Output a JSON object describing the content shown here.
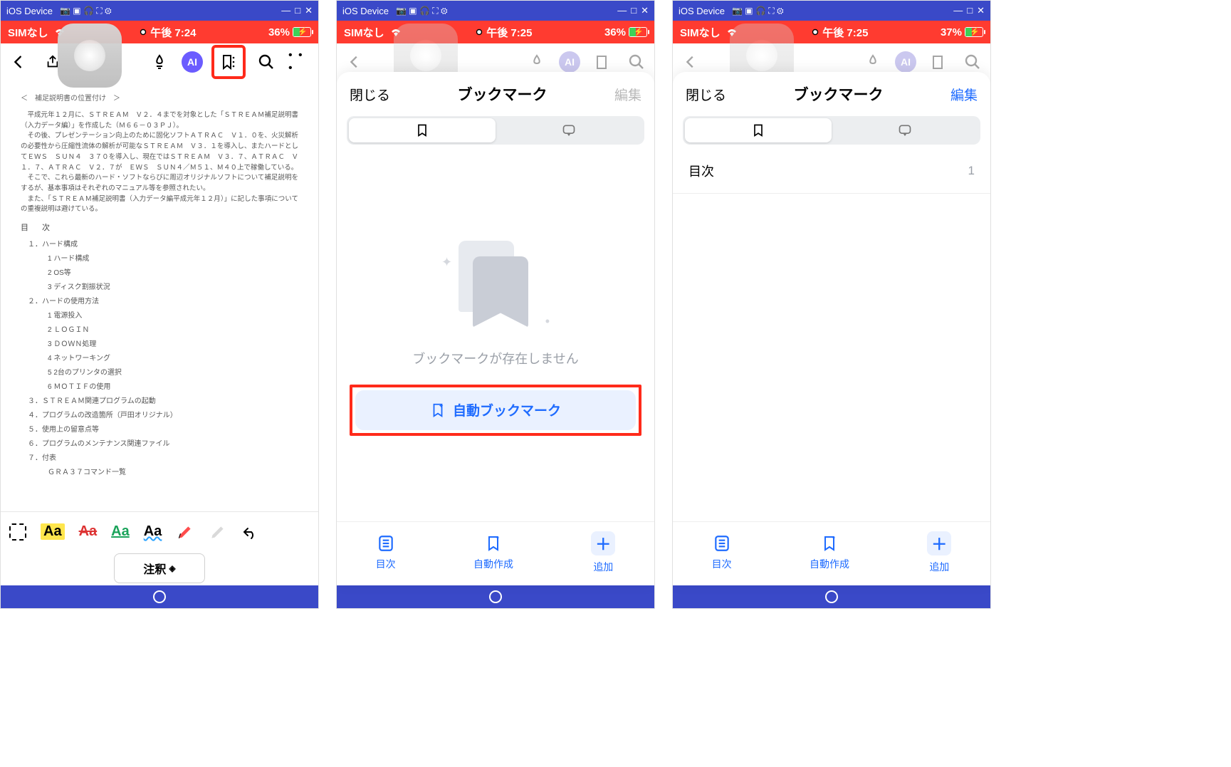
{
  "emu": {
    "device": "iOS Device",
    "min": "—",
    "sq": "□",
    "close": "✕"
  },
  "status": {
    "sim": "SIMなし",
    "time1": "午後 7:24",
    "time2": "午後 7:25",
    "time3": "午後 7:25",
    "batt1": "36%",
    "batt2": "36%",
    "batt3": "37%"
  },
  "toolbar": {
    "ai": "AI",
    "more": "• • •"
  },
  "doc": {
    "title": "＜　補足説明書の位置付け　＞",
    "para": "　平成元年１２月に、ＳＴＲＥＡＭ　Ｖ２．４までを対象とした「ＳＴＲＥＡＭ補足説明書（入力データ編）」を作成した（Ｍ６６－０３ＰＪ）。\n　その後、プレゼンテーション向上のために固化ソフトＡＴＲＡＣ　Ｖ１．０を、火災解析の必要性から圧縮性流体の解析が可能なＳＴＲＥＡＭ　Ｖ３．１を導入し、またハードとしてＥＷＳ　ＳＵＮ４　３７０を導入し、現在ではＳＴＲＥＡＭ　Ｖ３．７、ＡＴＲＡＣ　Ｖ１．７、ＡＴＲＡＣ　Ｖ２．７が　ＥＷＳ　ＳＵＮ４／Ｍ５１、Ｍ４０上で稼働している。\n　そこで、これら最新のハード・ソフトならびに周辺オリジナルソフトについて補足説明をするが、基本事項はそれぞれのマニュアル等を参照されたい。\n　また、「ＳＴＲＥＡＭ補足説明書（入力データ編平成元年１２月）」に記した事項についての重複説明は避けている。",
    "toc_h": "目　次",
    "toc": [
      "１．ハード構成",
      "　1 ハード構成",
      "　2 OS等",
      "　3 ディスク割振状況",
      "２．ハードの使用方法",
      "　1 電源投入",
      "　2 ＬＯＧＩＮ",
      "　3 ＤＯＷＮ処理",
      "　4 ネットワーキング",
      "　5 2台のプリンタの選択",
      "　6 ＭＯＴＩＦの使用",
      "３．ＳＴＲＥＡＭ関連プログラムの起動",
      "４．プログラムの改造箇所（戸田オリジナル）",
      "５．使用上の留意点等",
      "６．プログラムのメンテナンス関連ファイル",
      "７．付表",
      "　ＧＲＡ３７コマンド一覧"
    ]
  },
  "anno": {
    "label": "注釈",
    "caret": "◇"
  },
  "sheet": {
    "close": "閉じる",
    "title": "ブックマーク",
    "edit": "編集",
    "empty": "ブックマークが存在しません",
    "auto": "自動ブックマーク",
    "footer_toc": "目次",
    "footer_auto": "自動作成",
    "footer_add": "追加"
  },
  "bm_list": {
    "row1_title": "目次",
    "row1_page": "1"
  }
}
